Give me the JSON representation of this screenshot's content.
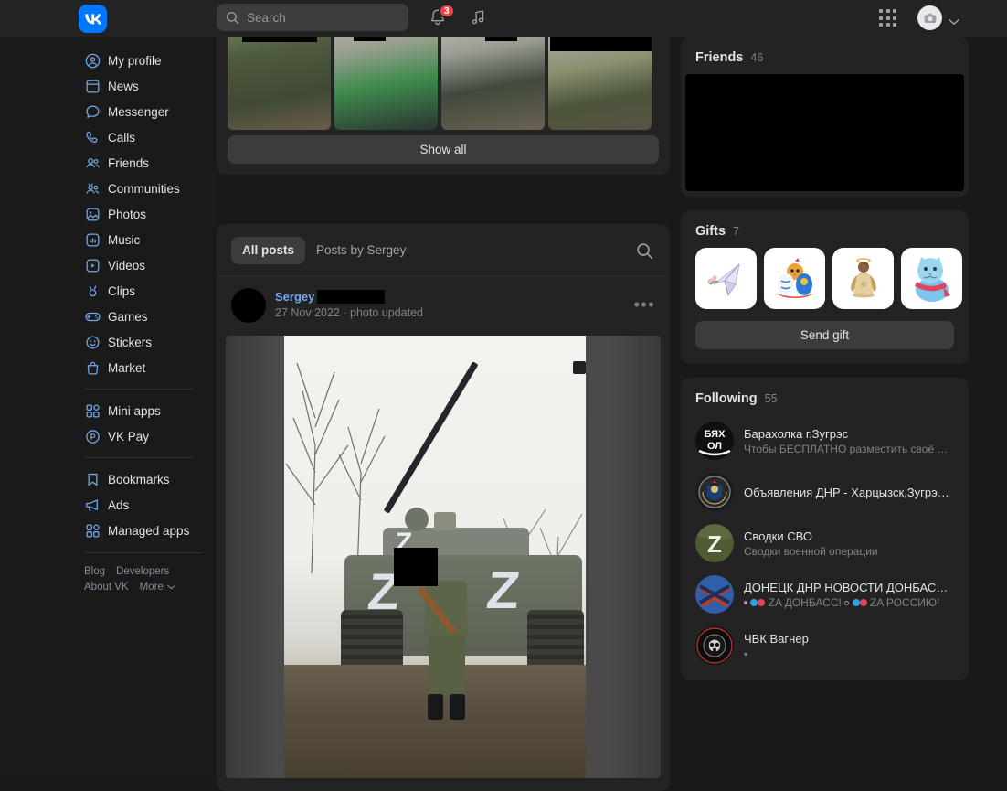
{
  "header": {
    "logo_alt": "VK",
    "search_placeholder": "Search",
    "notifications_badge": "3",
    "icons": {
      "bell": "bell-icon",
      "music": "music-note-icon",
      "apps_grid": "apps-grid-icon",
      "camera_avatar": "camera-avatar-icon",
      "chevron": "chevron-down-icon"
    }
  },
  "sidebar": {
    "groups": [
      {
        "items": [
          {
            "label": "My profile",
            "icon": "profile-icon"
          },
          {
            "label": "News",
            "icon": "news-icon"
          },
          {
            "label": "Messenger",
            "icon": "messenger-icon"
          },
          {
            "label": "Calls",
            "icon": "calls-icon"
          },
          {
            "label": "Friends",
            "icon": "friends-icon"
          },
          {
            "label": "Communities",
            "icon": "communities-icon"
          },
          {
            "label": "Photos",
            "icon": "photos-icon"
          },
          {
            "label": "Music",
            "icon": "music-icon"
          },
          {
            "label": "Videos",
            "icon": "videos-icon"
          },
          {
            "label": "Clips",
            "icon": "clips-icon"
          },
          {
            "label": "Games",
            "icon": "games-icon"
          },
          {
            "label": "Stickers",
            "icon": "stickers-icon"
          },
          {
            "label": "Market",
            "icon": "market-icon"
          }
        ]
      },
      {
        "items": [
          {
            "label": "Mini apps",
            "icon": "mini-apps-icon"
          },
          {
            "label": "VK Pay",
            "icon": "vk-pay-icon"
          }
        ]
      },
      {
        "items": [
          {
            "label": "Bookmarks",
            "icon": "bookmarks-icon"
          },
          {
            "label": "Ads",
            "icon": "ads-icon"
          },
          {
            "label": "Managed apps",
            "icon": "managed-apps-icon"
          }
        ]
      }
    ],
    "footer": {
      "row1": [
        "Blog",
        "Developers"
      ],
      "row2": [
        "About VK",
        "More"
      ],
      "more_chevron": "chevron-down-icon"
    }
  },
  "main": {
    "photos_card": {
      "show_all_label": "Show all",
      "rows": [
        {
          "cells": [
            {
              "alt": "photo-thumbnail",
              "redacted": false
            },
            {
              "alt": "photo-thumbnail",
              "redacted": false
            },
            {
              "alt": "photo-thumbnail",
              "redacted": false
            },
            {
              "alt": "photo-thumbnail",
              "redacted": false
            }
          ]
        },
        {
          "cells": [
            {
              "alt": "photo-thumbnail",
              "redacted": true
            },
            {
              "alt": "photo-thumbnail",
              "redacted": true
            },
            {
              "alt": "photo-thumbnail",
              "redacted": true
            },
            {
              "alt": "photo-thumbnail",
              "redacted": true
            }
          ]
        }
      ]
    },
    "posts": {
      "tabs": [
        {
          "label": "All posts",
          "active": true
        },
        {
          "label": "Posts by Sergey",
          "active": false
        }
      ],
      "search_icon": "search-icon",
      "post": {
        "author_name": "Sergey",
        "author_surname_redacted": true,
        "avatar_redacted": true,
        "date": "27 Nov 2022",
        "separator": "·",
        "action": "photo updated",
        "more_icon": "more-options-icon",
        "photo_alt": "post-photo-military-vehicle"
      }
    }
  },
  "right": {
    "friends": {
      "title": "Friends",
      "count": "46",
      "content_redacted": true
    },
    "gifts": {
      "title": "Gifts",
      "count": "7",
      "send_label": "Send gift",
      "items": [
        {
          "alt": "origami-bird-gift"
        },
        {
          "alt": "easter-eggs-chick-gift"
        },
        {
          "alt": "angel-bell-gift"
        },
        {
          "alt": "blue-cat-scarf-gift"
        }
      ]
    },
    "following": {
      "title": "Following",
      "count": "55",
      "items": [
        {
          "name": "Барахолка г.Зугрэс",
          "sub": "Чтобы БЕСПЛАТНО разместить своё объ…",
          "avatar": "barakholka-zugres-avatar"
        },
        {
          "name": "Объявления ДНР - Харцызск,Зугрэс,М…",
          "sub": "",
          "avatar": "dnr-ads-emblem-avatar"
        },
        {
          "name": "Сводки СВО",
          "sub": "Сводки военной операции",
          "avatar": "svodki-svo-z-avatar"
        },
        {
          "name": "ДОНЕЦК ДНР НОВОСТИ ДОНБАСС РО…",
          "sub": "ZA ДОНБАСС!  ZA РОССИЮ!",
          "avatar": "donetsk-dnr-flag-avatar"
        },
        {
          "name": "ЧВК Вагнер",
          "sub": "▪",
          "avatar": "wagner-skull-avatar"
        }
      ]
    }
  },
  "colors": {
    "page_bg": "#191919",
    "panel_bg": "#232324",
    "sidebar_bg": "#1a1a1a",
    "accent_blue": "#0077ff",
    "link_blue": "#71aaeb",
    "icon_blue": "#71aaeb",
    "badge_red": "#e64646",
    "text_primary": "#e1e3e6",
    "text_secondary": "#828282"
  }
}
